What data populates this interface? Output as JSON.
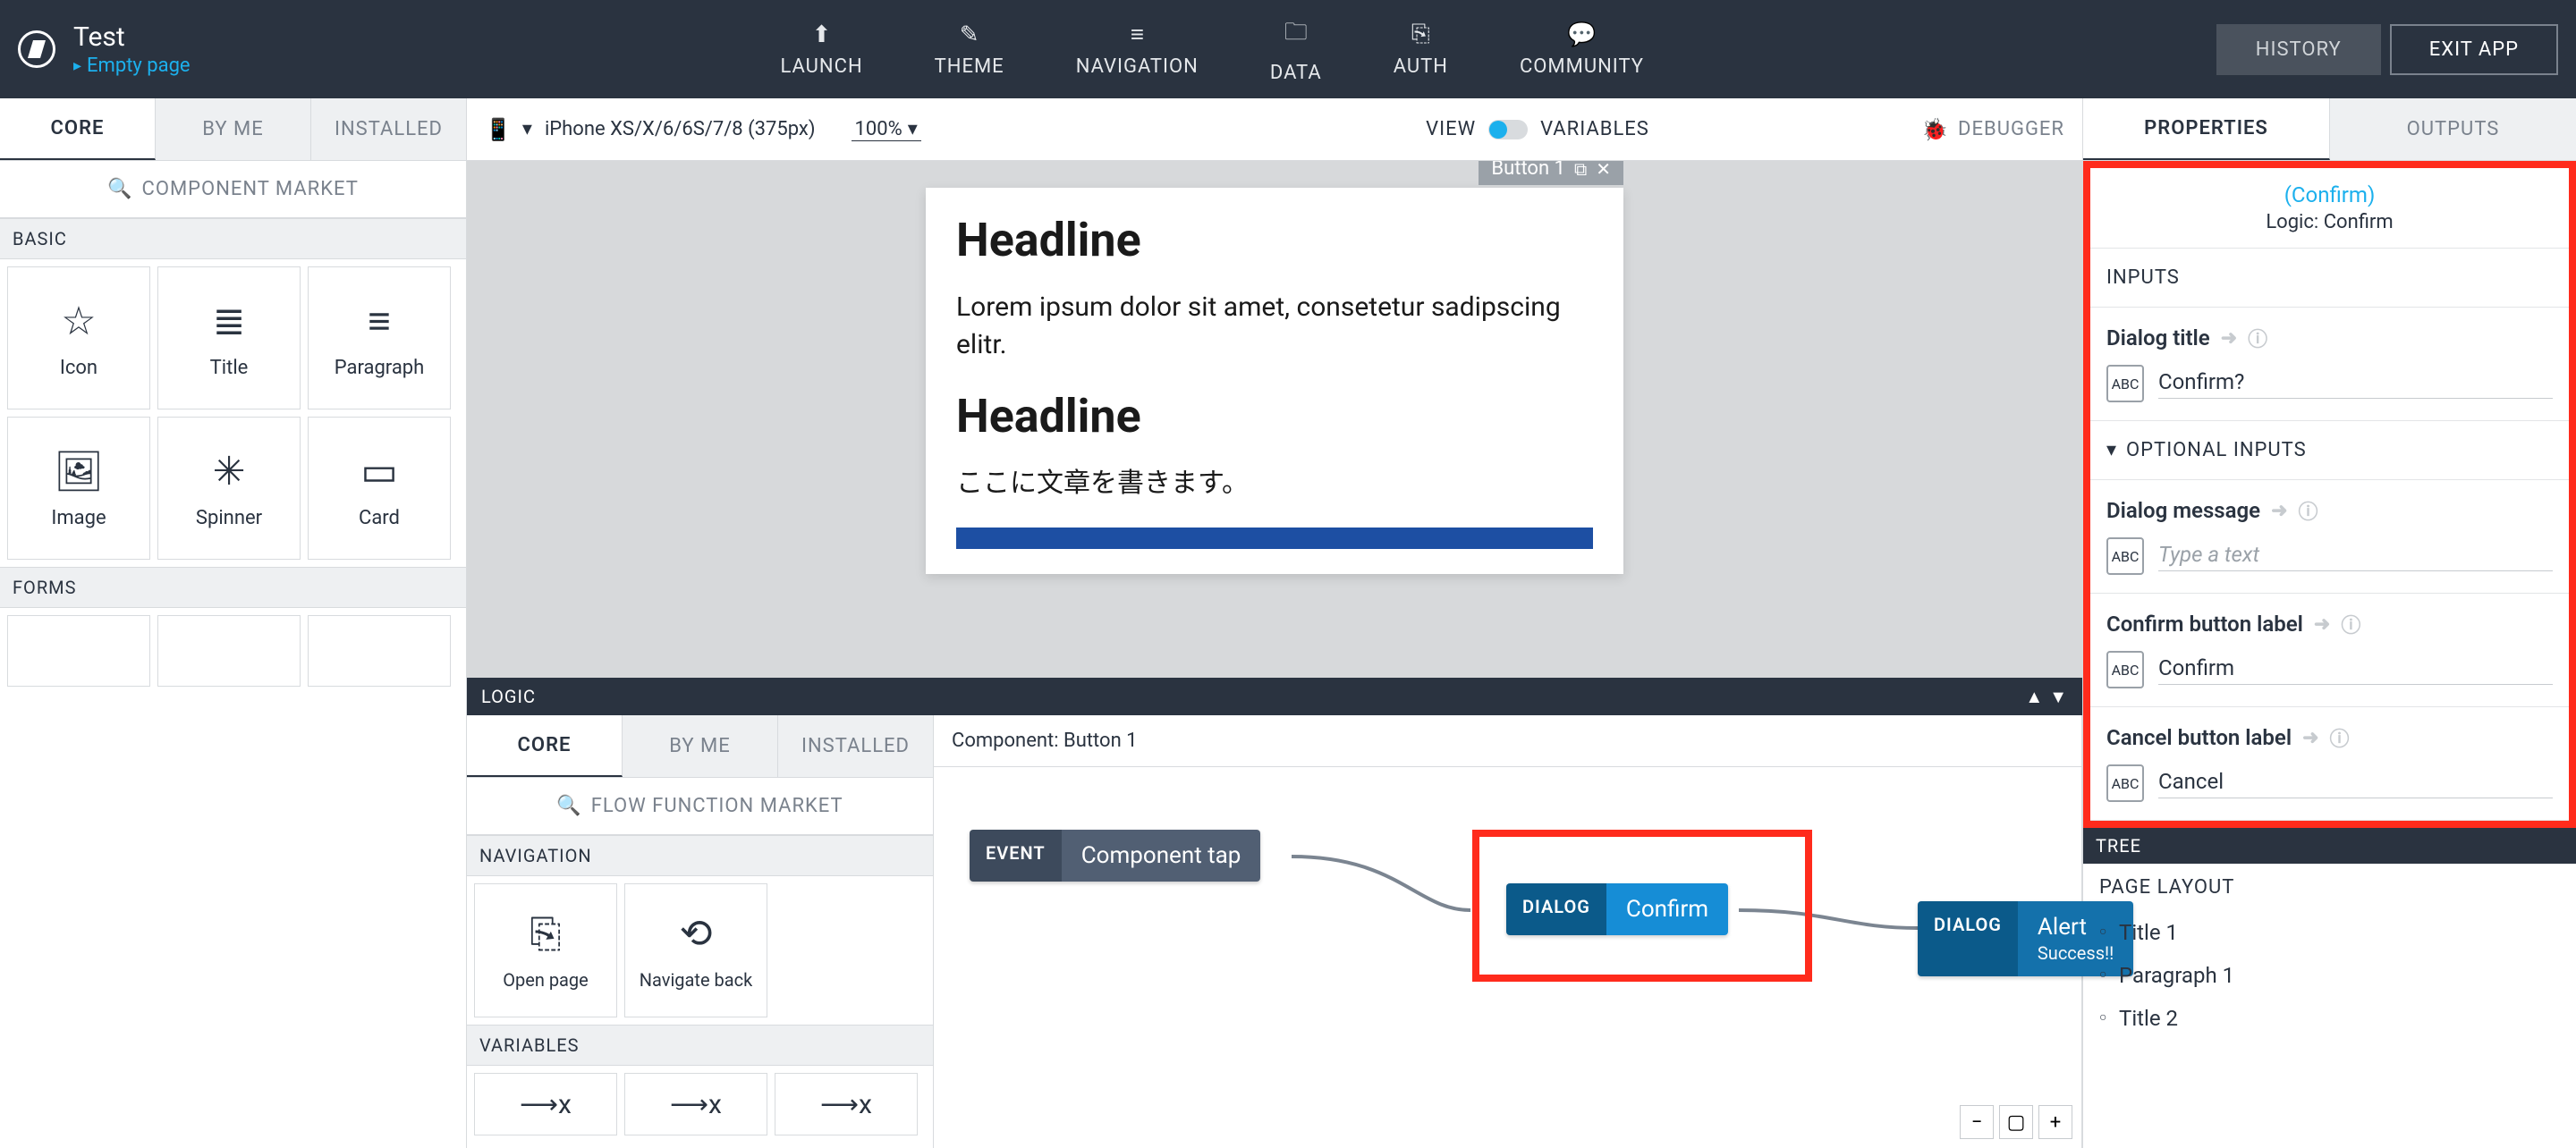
{
  "app": {
    "title": "Test",
    "breadcrumb": "Empty page"
  },
  "topnav": [
    {
      "icon": "⬆",
      "label": "LAUNCH"
    },
    {
      "icon": "✎",
      "label": "THEME"
    },
    {
      "icon": "≡",
      "label": "NAVIGATION"
    },
    {
      "icon": "🗀",
      "label": "DATA"
    },
    {
      "icon": "⎘",
      "label": "AUTH"
    },
    {
      "icon": "💬",
      "label": "COMMUNITY"
    }
  ],
  "topbuttons": {
    "history": "HISTORY",
    "exit": "EXIT APP"
  },
  "leftTabs": {
    "core": "CORE",
    "byme": "BY ME",
    "installed": "INSTALLED"
  },
  "componentMarket": "COMPONENT MARKET",
  "sections": {
    "basic": "BASIC",
    "forms": "FORMS"
  },
  "basicItems": [
    {
      "icon": "☆",
      "label": "Icon"
    },
    {
      "icon": "≣",
      "label": "Title"
    },
    {
      "icon": "≡",
      "label": "Paragraph"
    },
    {
      "icon": "🖼",
      "label": "Image"
    },
    {
      "icon": "✳",
      "label": "Spinner"
    },
    {
      "icon": "▭",
      "label": "Card"
    }
  ],
  "centerToolbar": {
    "device": "iPhone XS/X/6/6S/7/8 (375px)",
    "zoom": "100%",
    "view": "VIEW",
    "variables": "VARIABLES",
    "debugger": "DEBUGGER"
  },
  "canvas": {
    "h1a": "Headline",
    "p1": "Lorem ipsum dolor sit amet, consetetur sadipscing elitr.",
    "h1b": "Headline",
    "p2": "ここに文章を書きます。",
    "chip": "Button 1"
  },
  "logic": {
    "title": "LOGIC",
    "subtitle": "Component: Button 1",
    "flowMarket": "FLOW FUNCTION MARKET",
    "navSection": "NAVIGATION",
    "varsSection": "VARIABLES",
    "navItems": [
      {
        "icon": "⎘",
        "label": "Open page"
      },
      {
        "icon": "⟲",
        "label": "Navigate back"
      }
    ],
    "nodes": {
      "event": {
        "tag": "EVENT",
        "body": "Component tap"
      },
      "dialog": {
        "tag": "DIALOG",
        "body": "Confirm"
      },
      "alert": {
        "tag": "DIALOG",
        "body": "Alert",
        "sub": "Success!!"
      }
    }
  },
  "rightTabs": {
    "properties": "PROPERTIES",
    "outputs": "OUTPUTS"
  },
  "propHeader": {
    "name": "(Confirm)",
    "type": "Logic: Confirm"
  },
  "propGroups": {
    "inputs": "INPUTS",
    "optional": "OPTIONAL INPUTS"
  },
  "fields": {
    "dialogTitle": {
      "label": "Dialog title",
      "value": "Confirm?"
    },
    "dialogMessage": {
      "label": "Dialog message",
      "placeholder": "Type a text"
    },
    "confirmLabel": {
      "label": "Confirm button label",
      "value": "Confirm"
    },
    "cancelLabel": {
      "label": "Cancel button label",
      "value": "Cancel"
    }
  },
  "typeChip": "ABC",
  "tree": {
    "title": "TREE",
    "section": "PAGE LAYOUT",
    "items": [
      "Title 1",
      "Paragraph 1",
      "Title 2"
    ]
  }
}
